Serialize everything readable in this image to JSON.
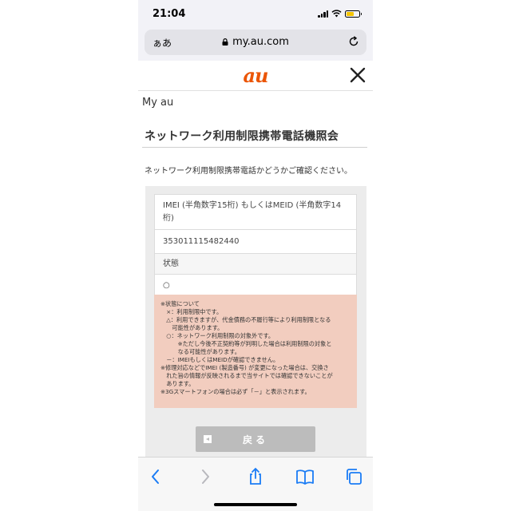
{
  "status_bar": {
    "time": "21:04"
  },
  "browser": {
    "aa_label": "ぁあ",
    "url": "my.au.com"
  },
  "header": {
    "logo": "au"
  },
  "page": {
    "brand": "My au",
    "title": "ネットワーク利用制限携帯電話機照会",
    "description": "ネットワーク利用制限携帯電話かどうかご確認ください。",
    "imei_label_line1": "IMEI (半角数字15桁) もしくはMEID (半角数字14",
    "imei_label_line2": "桁)",
    "imei_value": "353011115482440",
    "status_label": "状態",
    "status_value": "○",
    "notes": [
      "※状態について",
      "　×：利用制限中です。",
      "　△：利用できますが、代金債務の不履行等により利用制限となる",
      "　　可能性があります。",
      "　○：ネットワーク利用制限の対象外です。",
      "　　　※ただし今後不正契約等が判明した場合は利用制限の対象と",
      "　　　なる可能性があります。",
      "　－：IMEIもしくはMEIDが確認できません。",
      "※修理対応などでIMEI (製造番号) が変更になった場合は、交換さ",
      "　れた旨の情報が反映されるまで当サイトでは確認できないことが",
      "　あります。",
      "※3Gスマートフォンの場合は必ず「－」と表示されます。"
    ],
    "back_button": "戻る"
  },
  "colors": {
    "brand_orange": "#eb5505",
    "notes_bg": "#f2cdbf",
    "ios_blue": "#1a7cf5"
  }
}
